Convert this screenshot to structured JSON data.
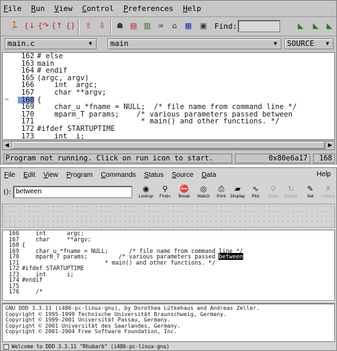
{
  "top": {
    "menu": [
      "File",
      "Run",
      "View",
      "Control",
      "Preferences",
      "Help"
    ],
    "find_label": "Find:",
    "find_value": "",
    "combos": {
      "file": "main.c",
      "function": "main",
      "mode": "SOURCE"
    },
    "code": [
      {
        "num": "162",
        "text": "# else"
      },
      {
        "num": "163",
        "text": "main"
      },
      {
        "num": "164",
        "text": "# endif"
      },
      {
        "num": "165",
        "text": "(argc, argv)"
      },
      {
        "num": "166",
        "text": "    int  argc;"
      },
      {
        "num": "167",
        "text": "    char **argv;"
      },
      {
        "num": "168",
        "text": "{",
        "current": true
      },
      {
        "num": "169",
        "text": "    char_u *fname = NULL;  /* file name from command line */"
      },
      {
        "num": "170",
        "text": "    mparm_T params;    /* various parameters passed between"
      },
      {
        "num": "171",
        "text": "                        * main() and other functions. */"
      },
      {
        "num": "172",
        "text": "#ifdef STARTUPTIME"
      },
      {
        "num": "173",
        "text": "    int  i;"
      }
    ],
    "current_marker": "~",
    "status_msg": "Program not running. Click on run icon to start.",
    "address": "0x80e6a17",
    "line_no": "168"
  },
  "bottom": {
    "menu": [
      "File",
      "Edit",
      "View",
      "Program",
      "Commands",
      "Status",
      "Source",
      "Data"
    ],
    "help": "Help",
    "arg_label": "():",
    "arg_value": "between",
    "buttons": [
      {
        "icon": "lookup-icon",
        "glyph": "◉",
        "label": "Lookup",
        "enabled": true
      },
      {
        "icon": "find-icon",
        "glyph": "⚲",
        "label": "Find»",
        "enabled": true
      },
      {
        "icon": "break-icon",
        "glyph": "⛔",
        "label": "Break",
        "enabled": true
      },
      {
        "icon": "watch-icon",
        "glyph": "◎",
        "label": "Watch",
        "enabled": true
      },
      {
        "icon": "print-icon",
        "glyph": "⎙",
        "label": "Print",
        "enabled": true
      },
      {
        "icon": "display-icon",
        "glyph": "▰",
        "label": "Display",
        "enabled": true
      },
      {
        "icon": "plot-icon",
        "glyph": "∿",
        "label": "Plot",
        "enabled": true
      },
      {
        "icon": "show-icon",
        "glyph": "⚲",
        "label": "Show",
        "enabled": false
      },
      {
        "icon": "rotate-icon",
        "glyph": "↻",
        "label": "Rotate",
        "enabled": false
      },
      {
        "icon": "set-icon",
        "glyph": "✎",
        "label": "Set",
        "enabled": true
      },
      {
        "icon": "undisp-icon",
        "glyph": "✗",
        "label": "Undisp",
        "enabled": false
      }
    ],
    "code": [
      {
        "num": "166",
        "pre": "    int      argc;",
        "hl": "",
        "post": ""
      },
      {
        "num": "167",
        "pre": "    char     **argv;",
        "hl": "",
        "post": ""
      },
      {
        "num": "168",
        "pre": "{",
        "hl": "",
        "post": ""
      },
      {
        "num": "169",
        "pre": "    char_u *fname = NULL;      /* file name from command line */",
        "hl": "",
        "post": ""
      },
      {
        "num": "170",
        "pre": "    mparm_T params;         /* various parameters passed ",
        "hl": "between",
        "post": ""
      },
      {
        "num": "171",
        "pre": "                        * main() and other functions. */",
        "hl": "",
        "post": ""
      },
      {
        "num": "172",
        "pre": "#ifdef STARTUPTIME",
        "hl": "",
        "post": ""
      },
      {
        "num": "173",
        "pre": "    int      i;",
        "hl": "",
        "post": ""
      },
      {
        "num": "174",
        "pre": "#endif",
        "hl": "",
        "post": ""
      },
      {
        "num": "175",
        "pre": "",
        "hl": "",
        "post": ""
      },
      {
        "num": "176",
        "pre": "    /*",
        "hl": "",
        "post": ""
      }
    ],
    "console": [
      "GNU DDD 3.3.11 (i486-pc-linux-gnu), by Dorothea Lütkehaus and Andreas Zeller.",
      "Copyright © 1995-1999 Technische Universität Braunschweig, Germany.",
      "Copyright © 1999-2001 Universität Passau, Germany.",
      "Copyright © 2001 Universität des Saarlandes, Germany.",
      "Copyright © 2001-2004 Free Software Foundation, Inc."
    ],
    "status_msg": "Welcome to DDD 3.3.11 \"Rhubarb\" (i486-pc-linux-gnu)"
  }
}
